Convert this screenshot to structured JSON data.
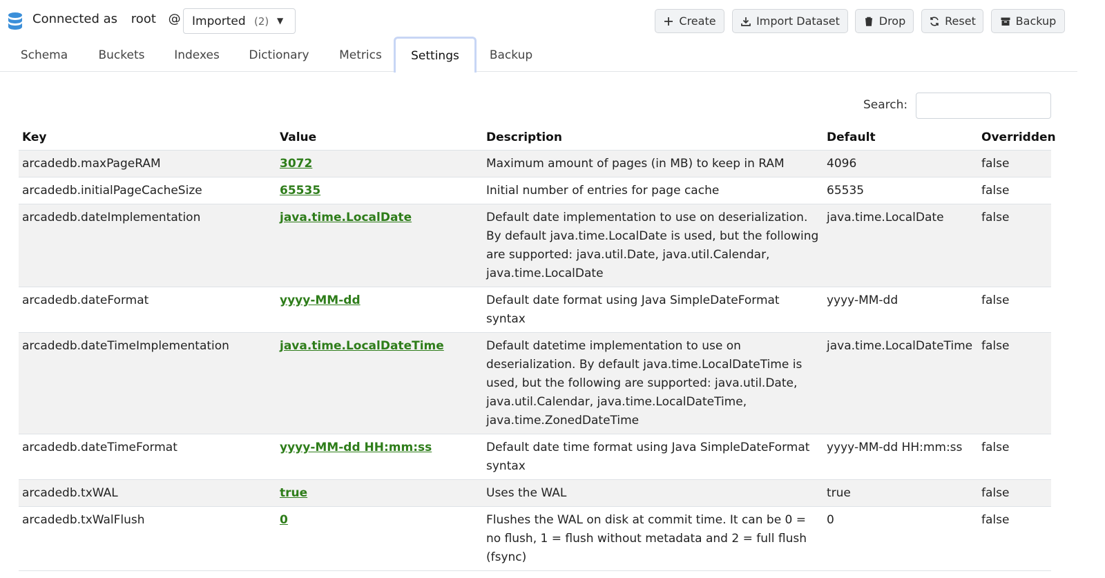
{
  "header": {
    "connected_label": "Connected as",
    "user": "root",
    "at": "@",
    "database": {
      "name": "Imported",
      "count": "(2)"
    },
    "buttons": [
      {
        "label": "Create",
        "icon": "plus-icon"
      },
      {
        "label": "Import Dataset",
        "icon": "download-icon"
      },
      {
        "label": "Drop",
        "icon": "trash-icon"
      },
      {
        "label": "Reset",
        "icon": "refresh-icon"
      },
      {
        "label": "Backup",
        "icon": "archive-icon"
      }
    ]
  },
  "tabs": [
    {
      "label": "Schema"
    },
    {
      "label": "Buckets"
    },
    {
      "label": "Indexes"
    },
    {
      "label": "Dictionary"
    },
    {
      "label": "Metrics"
    },
    {
      "label": "Settings",
      "active": true
    },
    {
      "label": "Backup"
    }
  ],
  "search": {
    "label": "Search:",
    "value": ""
  },
  "table": {
    "columns": [
      "Key",
      "Value",
      "Description",
      "Default",
      "Overridden"
    ],
    "rows": [
      {
        "key": "arcadedb.maxPageRAM",
        "value": "3072",
        "description": "Maximum amount of pages (in MB) to keep in RAM",
        "default": "4096",
        "overridden": "false"
      },
      {
        "key": "arcadedb.initialPageCacheSize",
        "value": "65535",
        "description": "Initial number of entries for page cache",
        "default": "65535",
        "overridden": "false"
      },
      {
        "key": "arcadedb.dateImplementation",
        "value": "java.time.LocalDate",
        "description": "Default date implementation to use on deserialization. By default java.time.LocalDate is used, but the following are supported: java.util.Date, java.util.Calendar, java.time.LocalDate",
        "default": "java.time.LocalDate",
        "overridden": "false"
      },
      {
        "key": "arcadedb.dateFormat",
        "value": "yyyy-MM-dd",
        "description": "Default date format using Java SimpleDateFormat syntax",
        "default": "yyyy-MM-dd",
        "overridden": "false"
      },
      {
        "key": "arcadedb.dateTimeImplementation",
        "value": "java.time.LocalDateTime",
        "description": "Default datetime implementation to use on deserialization. By default java.time.LocalDateTime is used, but the following are supported: java.util.Date, java.util.Calendar, java.time.LocalDateTime, java.time.ZonedDateTime",
        "default": "java.time.LocalDateTime",
        "overridden": "false"
      },
      {
        "key": "arcadedb.dateTimeFormat",
        "value": "yyyy-MM-dd HH:mm:ss",
        "description": "Default date time format using Java SimpleDateFormat syntax",
        "default": "yyyy-MM-dd HH:mm:ss",
        "overridden": "false"
      },
      {
        "key": "arcadedb.txWAL",
        "value": "true",
        "description": "Uses the WAL",
        "default": "true",
        "overridden": "false"
      },
      {
        "key": "arcadedb.txWalFlush",
        "value": "0",
        "description": "Flushes the WAL on disk at commit time. It can be 0 = no flush, 1 = flush without metadata and 2 = full flush (fsync)",
        "default": "0",
        "overridden": "false"
      }
    ]
  },
  "colors": {
    "accent": "#2e7d1a",
    "db_icon": "#3b8fd9",
    "active_tab_border": "#c8d6f5"
  }
}
